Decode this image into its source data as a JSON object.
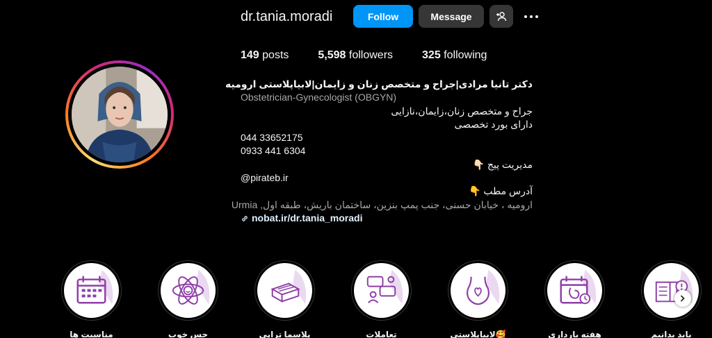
{
  "profile": {
    "username": "dr.tania.moradi",
    "follow_label": "Follow",
    "message_label": "Message",
    "add_user_icon": "add-user-icon",
    "more_icon": "more-options-icon"
  },
  "stats": {
    "posts_count": "149",
    "posts_label": " posts",
    "followers_count": "5,598",
    "followers_label": " followers",
    "following_count": "325",
    "following_label": " following"
  },
  "bio": {
    "name": "دکتر تانیا مرادی|جراح و متخصص زنان و زایمان|لابیاپلاستی ارومیه",
    "category": "Obstetrician-Gynecologist (OBGYN)",
    "lines": [
      "جراح و متخصص زنان،زایمان،نازایی",
      "دارای بورد تخصصی",
      "044 33652175",
      "0933 441 6304",
      "مدیریت پیج 👇🏻",
      "@pirateb.ir",
      "آدرس مطب 👇",
      "ارومیه ، خیابان حسنی، جنب پمپ بنزین، ساختمان باریش، طبقه اول, Urmia"
    ],
    "link": "nobat.ir/dr.tania_moradi"
  },
  "highlights": [
    {
      "label": "مناسبت ها",
      "icon": "calendar-icon"
    },
    {
      "label": "حس خوب",
      "icon": "atom-smile-icon"
    },
    {
      "label": "پلاسما تراپی",
      "icon": "box-icon"
    },
    {
      "label": "تعاملات",
      "icon": "chat-people-icon"
    },
    {
      "label": "لابیاپلاستی🥰",
      "icon": "vase-heart-icon"
    },
    {
      "label": "هفته بارداری",
      "icon": "pregnancy-calendar-icon"
    },
    {
      "label": "باید بدانیم",
      "icon": "book-alert-icon"
    }
  ],
  "colors": {
    "follow_button": "#0095f6",
    "secondary_button": "#363636",
    "highlight_icon": "#8e3fa8",
    "link_text": "#e0f1ff"
  }
}
